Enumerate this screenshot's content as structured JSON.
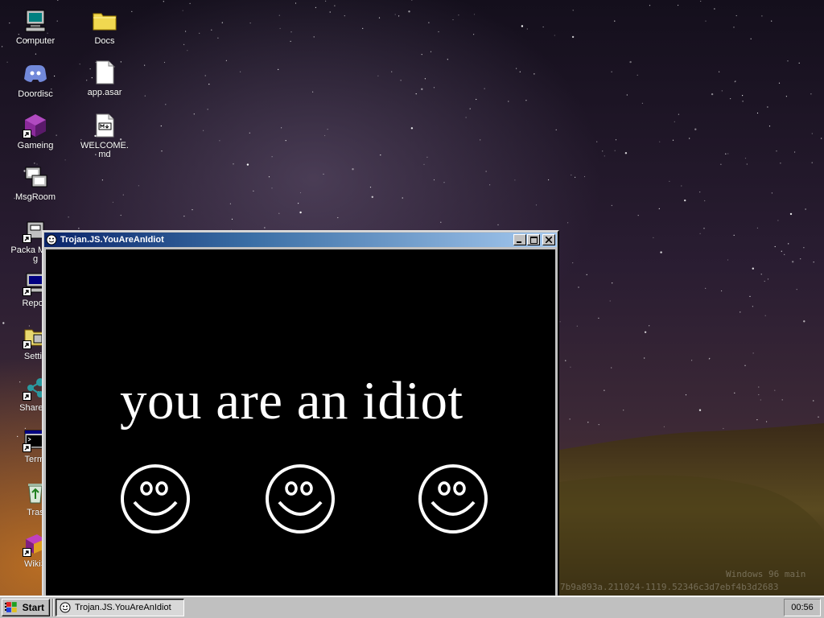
{
  "desktop": {
    "icons": [
      {
        "label": "Computer"
      },
      {
        "label": "Doordisc"
      },
      {
        "label": "Gameing"
      },
      {
        "label": "MsgRoom"
      },
      {
        "label": "Packa Manag"
      },
      {
        "label": "Report"
      },
      {
        "label": "Settin"
      },
      {
        "label": "Share E"
      },
      {
        "label": "Termi"
      },
      {
        "label": "Tras"
      },
      {
        "label": "WikiS"
      },
      {
        "label": "Docs"
      },
      {
        "label": "app.asar"
      },
      {
        "label": "WELCOME.md"
      }
    ],
    "watermark": {
      "line1": "Windows 96 main",
      "line2": "7b9a893a.211024-1119.52346c3d7ebf4b3d2683"
    }
  },
  "window": {
    "title": "Trojan.JS.YouAreAnIdiot",
    "message": "you are an idiot",
    "smiley_count": 3,
    "active": true
  },
  "taskbar": {
    "start_label": "Start",
    "task_label": "Trojan.JS.YouAreAnIdiot",
    "clock": "00:56"
  }
}
